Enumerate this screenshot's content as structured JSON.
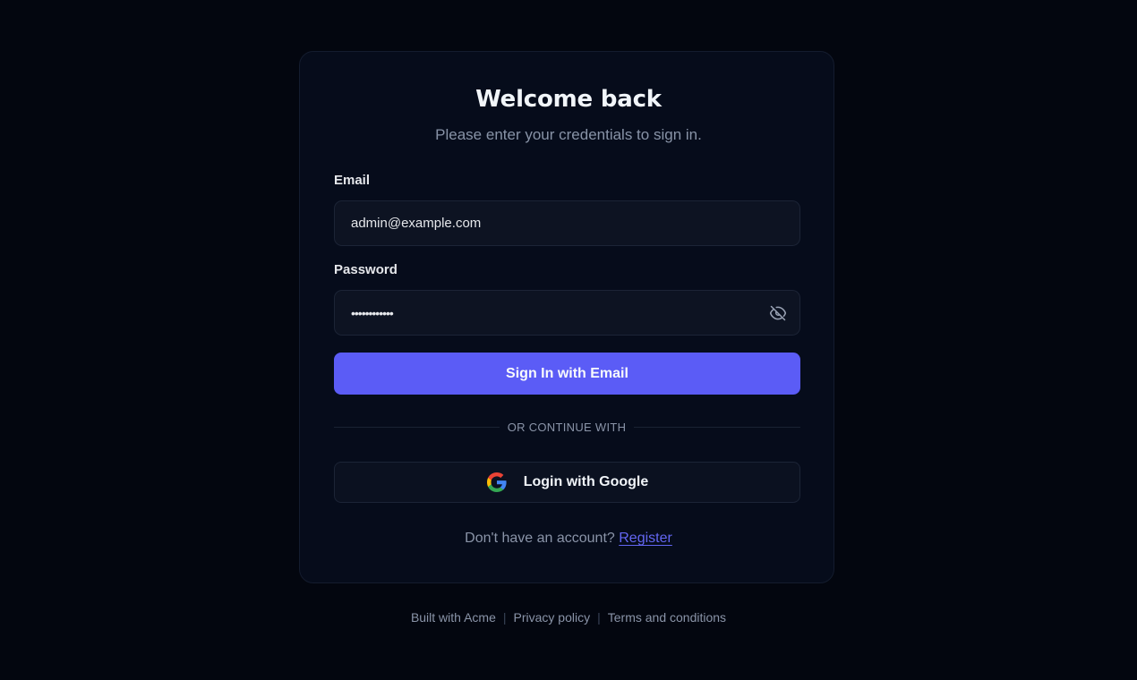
{
  "heading": {
    "title": "Welcome back",
    "subtitle": "Please enter your credentials to sign in."
  },
  "form": {
    "email_label": "Email",
    "email_value": "admin@example.com",
    "password_label": "Password",
    "password_value": "••••••••••••",
    "submit_label": "Sign In with Email",
    "divider_text": "OR CONTINUE WITH",
    "google_label": "Login with Google"
  },
  "register": {
    "prompt": "Don't have an account?",
    "link": "Register"
  },
  "footer": {
    "links": [
      "Built with Acme",
      "Privacy policy",
      "Terms and conditions"
    ],
    "separator": "|"
  },
  "colors": {
    "background": "#03060f",
    "card": "#060c1b",
    "accent": "#5b5cf6",
    "link": "#6366f1"
  },
  "icons": {
    "password_toggle": "eye-off-icon",
    "google": "google-icon"
  }
}
